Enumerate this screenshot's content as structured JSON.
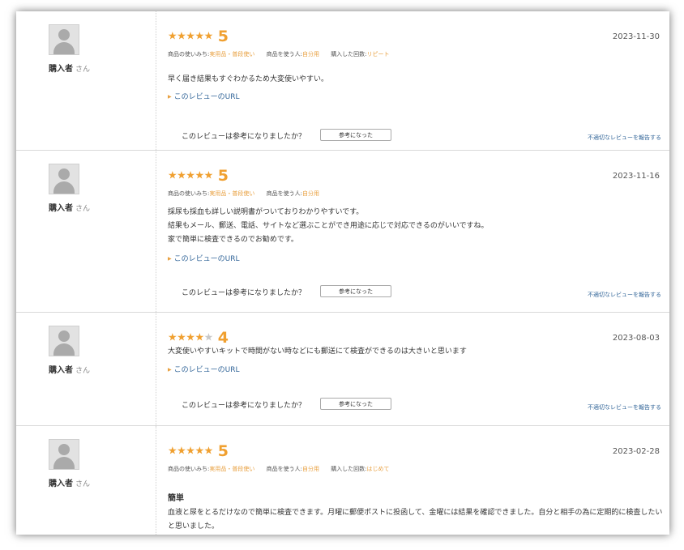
{
  "common": {
    "buyer_label": "購入者",
    "buyer_suffix": "さん",
    "url_link": "このレビューのURL",
    "helpful_question": "このレビューは参考になりましたか？",
    "helpful_button": "参考になった",
    "report_link": "不適切なレビューを報告する",
    "star_icon": "★",
    "accent_color": "#f0a030"
  },
  "reviews": [
    {
      "rating": 5,
      "stars_on": "★★★★★",
      "stars_off": "",
      "score": "5",
      "date": "2023-11-30",
      "usage_label": "商品の使いみち:",
      "usage_value": "実用品・普段使い",
      "user_label": "商品を使う人:",
      "user_value": "自分用",
      "count_label": "購入した回数:",
      "count_value": "リピート",
      "title": "",
      "text": "早く届き結果もすぐわかるため大変使いやすい。"
    },
    {
      "rating": 5,
      "stars_on": "★★★★★",
      "stars_off": "",
      "score": "5",
      "date": "2023-11-16",
      "usage_label": "商品の使いみち:",
      "usage_value": "実用品・普段使い",
      "user_label": "商品を使う人:",
      "user_value": "自分用",
      "title": "",
      "text_lines": [
        "採尿も採血も詳しい説明書がついておりわかりやすいです。",
        "結果もメール、郵送、電話、サイトなど選ぶことができ用途に応じで対応できるのがいいですね。",
        "家で簡単に検査できるのでお勧めです。"
      ]
    },
    {
      "rating": 4,
      "stars_on": "★★★★",
      "stars_off": "★",
      "score": "4",
      "date": "2023-08-03",
      "title": "",
      "text": "大変使いやすいキットで時間がない時などにも郵送にて検査ができるのは大きいと思います"
    },
    {
      "rating": 5,
      "stars_on": "★★★★★",
      "stars_off": "",
      "score": "5",
      "date": "2023-02-28",
      "usage_label": "商品の使いみち:",
      "usage_value": "実用品・普段使い",
      "user_label": "商品を使う人:",
      "user_value": "自分用",
      "count_label": "購入した回数:",
      "count_value": "はじめて",
      "title": "簡単",
      "text": "血液と尿をとるだけなので簡単に検査できます。月曜に郵便ポストに投函して、金曜には結果を確認できました。自分と相手の為に定期的に検査したいと思いました。"
    }
  ]
}
